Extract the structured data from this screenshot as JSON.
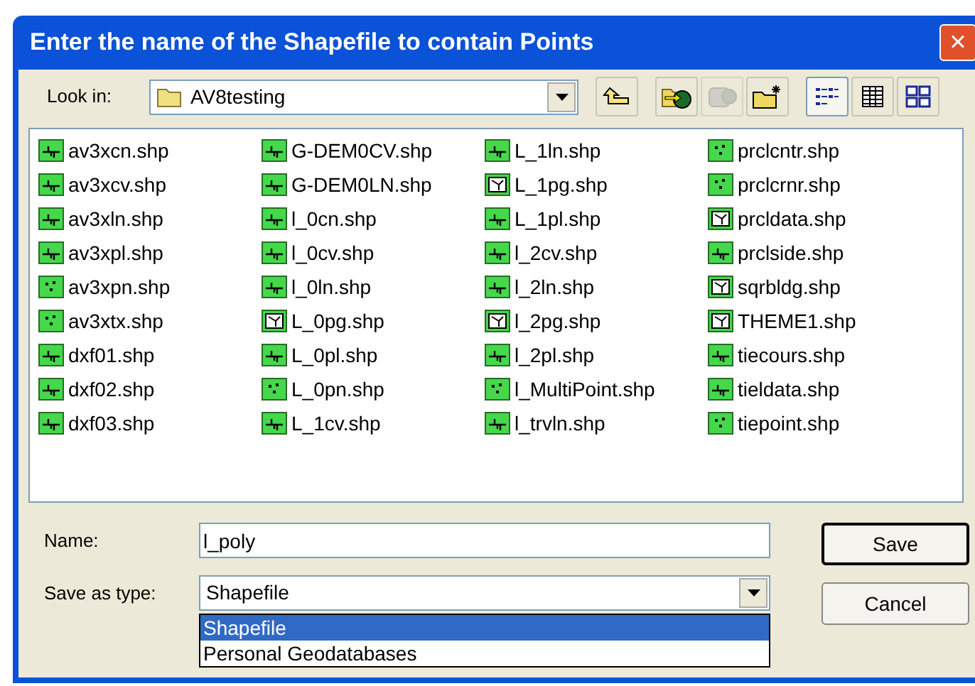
{
  "window": {
    "title": "Enter the name of the Shapefile to contain Points",
    "close_button": "×"
  },
  "look_in": {
    "label": "Look in:",
    "value": "AV8testing"
  },
  "toolbar": [
    {
      "kind": "up",
      "disabled": false,
      "selected": false
    },
    {
      "kind": "goto",
      "disabled": false,
      "selected": false
    },
    {
      "kind": "connect",
      "disabled": true,
      "selected": false
    },
    {
      "kind": "newfolder",
      "disabled": false,
      "selected": false
    },
    {
      "kind": "list",
      "disabled": false,
      "selected": true
    },
    {
      "kind": "details",
      "disabled": false,
      "selected": false
    },
    {
      "kind": "thumbnails",
      "disabled": false,
      "selected": false
    }
  ],
  "files": [
    {
      "name": "av3xcn.shp",
      "kind": "line"
    },
    {
      "name": "av3xcv.shp",
      "kind": "line"
    },
    {
      "name": "av3xln.shp",
      "kind": "line"
    },
    {
      "name": "av3xpl.shp",
      "kind": "line"
    },
    {
      "name": "av3xpn.shp",
      "kind": "point"
    },
    {
      "name": "av3xtx.shp",
      "kind": "point"
    },
    {
      "name": "dxf01.shp",
      "kind": "line"
    },
    {
      "name": "dxf02.shp",
      "kind": "line"
    },
    {
      "name": "dxf03.shp",
      "kind": "line"
    },
    {
      "name": "G-DEM0CV.shp",
      "kind": "line"
    },
    {
      "name": "G-DEM0LN.shp",
      "kind": "line"
    },
    {
      "name": "l_0cn.shp",
      "kind": "line"
    },
    {
      "name": "l_0cv.shp",
      "kind": "line"
    },
    {
      "name": "l_0ln.shp",
      "kind": "line"
    },
    {
      "name": "L_0pg.shp",
      "kind": "polygon"
    },
    {
      "name": "L_0pl.shp",
      "kind": "line"
    },
    {
      "name": "L_0pn.shp",
      "kind": "point"
    },
    {
      "name": "L_1cv.shp",
      "kind": "line"
    },
    {
      "name": "L_1ln.shp",
      "kind": "line"
    },
    {
      "name": "L_1pg.shp",
      "kind": "polygon"
    },
    {
      "name": "L_1pl.shp",
      "kind": "line"
    },
    {
      "name": "l_2cv.shp",
      "kind": "line"
    },
    {
      "name": "l_2ln.shp",
      "kind": "line"
    },
    {
      "name": "l_2pg.shp",
      "kind": "polygon"
    },
    {
      "name": "l_2pl.shp",
      "kind": "line"
    },
    {
      "name": "l_MultiPoint.shp",
      "kind": "point"
    },
    {
      "name": "l_trvln.shp",
      "kind": "line"
    },
    {
      "name": "prclcntr.shp",
      "kind": "point"
    },
    {
      "name": "prclcrnr.shp",
      "kind": "point"
    },
    {
      "name": "prcldata.shp",
      "kind": "polygon"
    },
    {
      "name": "prclside.shp",
      "kind": "line"
    },
    {
      "name": "sqrbldg.shp",
      "kind": "polygon"
    },
    {
      "name": "THEME1.shp",
      "kind": "polygon"
    },
    {
      "name": "tiecours.shp",
      "kind": "line"
    },
    {
      "name": "tieldata.shp",
      "kind": "line"
    },
    {
      "name": "tiepoint.shp",
      "kind": "point"
    }
  ],
  "name_field": {
    "label": "Name:",
    "value": "l_poly"
  },
  "type_field": {
    "label": "Save as type:",
    "value": "Shapefile"
  },
  "type_options": [
    {
      "label": "Shapefile",
      "selected": true
    },
    {
      "label": "Personal Geodatabases",
      "selected": false
    }
  ],
  "buttons": [
    {
      "label": "Save",
      "default": true
    },
    {
      "label": "Cancel",
      "default": false
    }
  ]
}
